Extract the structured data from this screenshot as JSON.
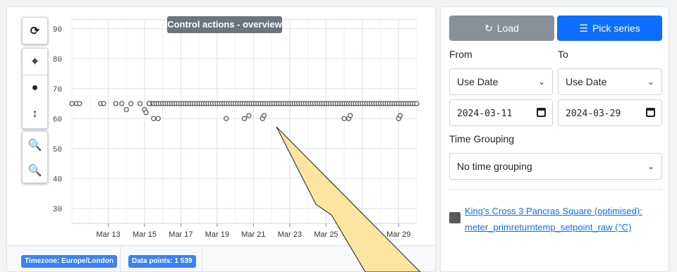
{
  "chart": {
    "title": "Control actions - overview",
    "toolbar": {
      "refresh": "refresh-icon",
      "crosshair": "crosshair-icon",
      "point": "circle-icon",
      "vertical_pan": "arrows-vertical-icon",
      "zoom_in": "zoom-in-icon",
      "zoom_out": "zoom-out-icon"
    }
  },
  "chart_data": {
    "type": "scatter",
    "title": "Control actions - overview",
    "xlabel": "",
    "ylabel": "",
    "x_ticks": [
      "Mar 13",
      "Mar 15",
      "Mar 17",
      "Mar 19",
      "Mar 21",
      "Mar 23",
      "Mar 25",
      "Mar 27",
      "Mar 29"
    ],
    "y_ticks": [
      30,
      40,
      50,
      60,
      70,
      80,
      90
    ],
    "xlim": [
      "2024-03-11",
      "2024-03-30"
    ],
    "ylim": [
      25,
      93
    ],
    "grid": true,
    "series": [
      {
        "color": "#5a5a5a",
        "points": [
          [
            "2024-03-11T00:00",
            65
          ],
          [
            "2024-03-11T06:00",
            65
          ],
          [
            "2024-03-11T10:00",
            65
          ],
          [
            "2024-03-12T14:00",
            65
          ],
          [
            "2024-03-12T18:00",
            65
          ],
          [
            "2024-03-13T10:00",
            65
          ],
          [
            "2024-03-13T18:00",
            65
          ],
          [
            "2024-03-14T00:00",
            63
          ],
          [
            "2024-03-14T06:00",
            65
          ],
          [
            "2024-03-14T18:00",
            65
          ],
          [
            "2024-03-15T00:00",
            63
          ],
          [
            "2024-03-15T02:00",
            62
          ],
          [
            "2024-03-15T06:00",
            65
          ],
          [
            "2024-03-15T12:00",
            60
          ],
          [
            "2024-03-15T18:00",
            60
          ],
          [
            "2024-03-19T12:00",
            60
          ],
          [
            "2024-03-20T12:00",
            60
          ],
          [
            "2024-03-20T18:00",
            61
          ],
          [
            "2024-03-21T12:00",
            60
          ],
          [
            "2024-03-21T14:00",
            61
          ],
          [
            "2024-03-26T00:00",
            60
          ],
          [
            "2024-03-26T06:00",
            60
          ],
          [
            "2024-03-26T08:00",
            61
          ],
          [
            "2024-03-29T00:00",
            60
          ],
          [
            "2024-03-29T02:00",
            61
          ]
        ],
        "continuous_band": {
          "from": "2024-03-15T06:00",
          "to": "2024-03-30T00:00",
          "value": 65
        }
      }
    ]
  },
  "footer": {
    "timezone": "Timezone: Europe/London",
    "data_points": "Data points: 1 539"
  },
  "panel": {
    "load_label": "Load",
    "pick_label": "Pick series",
    "from_label": "From",
    "to_label": "To",
    "from_mode": "Use Date",
    "to_mode": "Use Date",
    "from_date": "2024-03-11",
    "to_date": "2024-03-29",
    "grouping_label": "Time Grouping",
    "grouping_value": "No time grouping",
    "series_link": "King's Cross 3 Pancras Square (optimised): meter_primreturntemp_setpoint_raw (°C)",
    "series_color": "#5a5a5a"
  }
}
